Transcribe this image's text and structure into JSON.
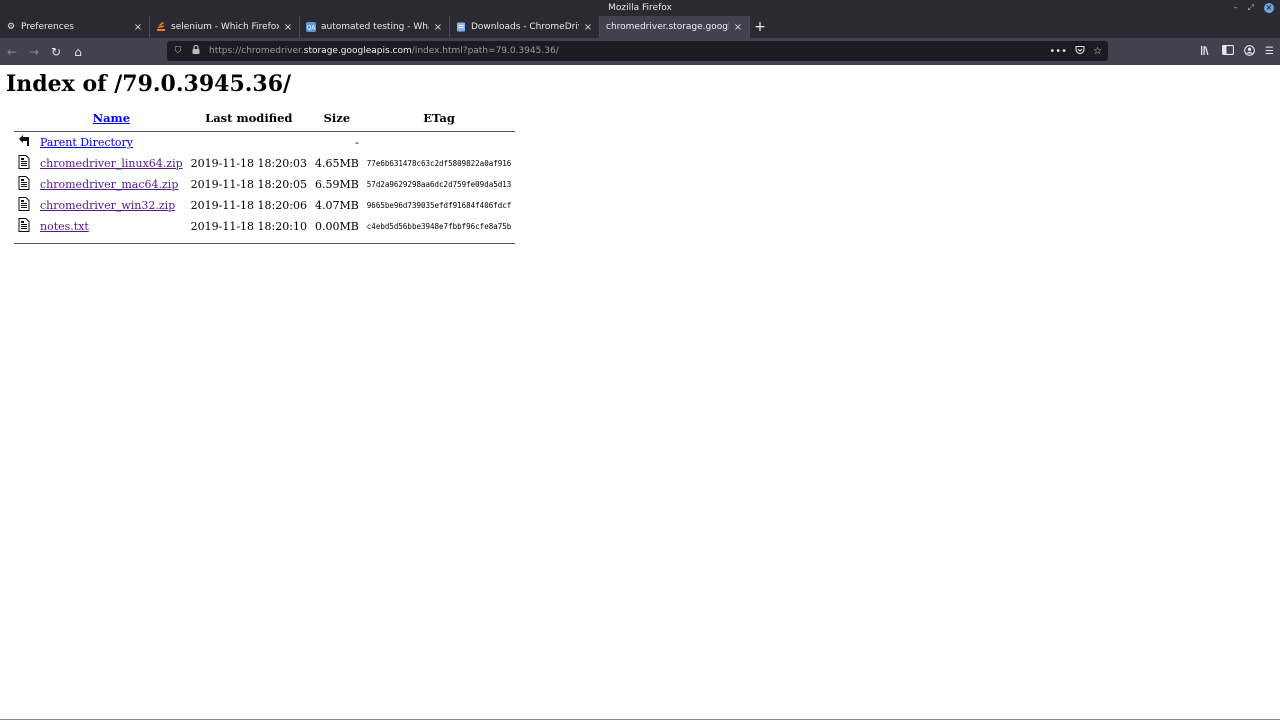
{
  "window": {
    "title": "Mozilla Firefox"
  },
  "tabs": [
    {
      "label": "Preferences",
      "icon": "gear-icon"
    },
    {
      "label": "selenium - Which Firefox b",
      "icon": "stackoverflow-icon"
    },
    {
      "label": "automated testing - What i",
      "icon": "sqa-icon"
    },
    {
      "label": "Downloads - ChromeDriver",
      "icon": "page-icon"
    },
    {
      "label": "chromedriver.storage.googlea",
      "icon": "none"
    }
  ],
  "url": {
    "prefix": "https://chromedriver.",
    "host": "storage.googleapis.com",
    "path": "/index.html?path=79.0.3945.36/"
  },
  "page": {
    "title": "Index of /79.0.3945.36/",
    "headers": {
      "name": "Name",
      "modified": "Last modified",
      "size": "Size",
      "etag": "ETag"
    },
    "parent": {
      "label": "Parent Directory",
      "size": "-"
    },
    "files": [
      {
        "name": "chromedriver_linux64.zip",
        "modified": "2019-11-18 18:20:03",
        "size": "4.65MB",
        "etag": "77e6b631478c63c2df5809822a0af916"
      },
      {
        "name": "chromedriver_mac64.zip",
        "modified": "2019-11-18 18:20:05",
        "size": "6.59MB",
        "etag": "57d2a9629298aa6dc2d759fe09da5d13"
      },
      {
        "name": "chromedriver_win32.zip",
        "modified": "2019-11-18 18:20:06",
        "size": "4.07MB",
        "etag": "9665be96d739035efdf91684f406fdcf"
      },
      {
        "name": "notes.txt",
        "modified": "2019-11-18 18:20:10",
        "size": "0.00MB",
        "etag": "c4ebd5d56bbe3948e7fbbf96cfe8a75b"
      }
    ]
  }
}
